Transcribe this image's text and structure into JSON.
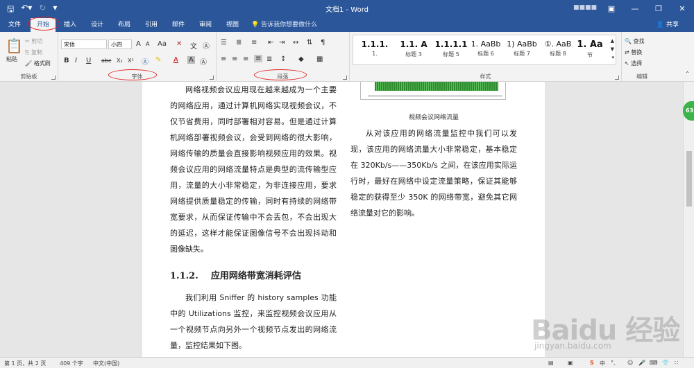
{
  "titlebar": {
    "title": "文档1 - Word",
    "user_label": "■■■■",
    "quick_access": [
      "save",
      "undo",
      "redo",
      "customize"
    ],
    "window_buttons": [
      "ribbon-display",
      "minimize",
      "restore",
      "close"
    ]
  },
  "tabs": {
    "items": [
      "文件",
      "开始",
      "插入",
      "设计",
      "布局",
      "引用",
      "邮件",
      "审阅",
      "视图"
    ],
    "active": "开始",
    "tell_me": "告诉我你想要做什么",
    "share": "共享"
  },
  "ribbon": {
    "clipboard": {
      "paste": "粘贴",
      "cut": "剪切",
      "copy": "复制",
      "format_painter": "格式刷",
      "label": "剪贴板"
    },
    "font": {
      "font_name": "宋体",
      "font_size": "小四",
      "grow": "A",
      "shrink": "A",
      "case": "Aa",
      "label": "字体",
      "buttons": [
        "B",
        "I",
        "U",
        "abc",
        "X₂",
        "X²"
      ]
    },
    "paragraph": {
      "label": "段落"
    },
    "styles": {
      "label": "样式",
      "items": [
        {
          "sample": "1.1.1.",
          "name": "1."
        },
        {
          "sample": "1.1.  A",
          "name": "标题 3"
        },
        {
          "sample": "1.1.1.1",
          "name": "标题 5"
        },
        {
          "sample": "1. AaBb",
          "name": "标题 6"
        },
        {
          "sample": "1) AaBb",
          "name": "标题 7"
        },
        {
          "sample": "①. AaB",
          "name": "标题 8"
        },
        {
          "sample": "1. Aa",
          "name": "节"
        }
      ]
    },
    "editing": {
      "find": "查找",
      "replace": "替换",
      "select": "选择",
      "label": "编辑"
    }
  },
  "document": {
    "col1_para1": "网络视频会议应用现在越来越成为一个主要的网络应用，通过计算机网络实现视频会议，不仅节省费用，同时部署相对容易。但是通过计算机网络部署视频会议，会受到网络的很大影响，网络传输的质量会直接影响视频应用的效果。视频会议应用的网络流量特点是典型的流传输型应用，流量的大小非常稳定，为非连接应用，要求网络提供质量稳定的传输，同时有持续的网络带宽要求，从而保证传输中不会丢包，不会出现大的延迟，这样才能保证图像信号不会出现抖动和图像缺失。",
    "heading": "1.1.2.    应用网络带宽消耗评估",
    "col1_para2": "我们利用 Sniffer 的 history samples 功能中的 Utilizations 监控，来监控视频会议应用从一个视频节点向另外一个视频节点发出的网络流量，监控结果如下图。",
    "figure_caption": "视频会议网络流量",
    "col2_para": "从对该应用的网络流量监控中我们可以发现，该应用的网络流量大小非常稳定，基本稳定在 320Kb/s——350Kb/s 之间，在该应用实际运行时，最好在网络中设定流量策略，保证其能够稳定的获得至少 350K 的网络带宽，避免其它网络流量对它的影响。"
  },
  "scroll_badge": "63",
  "statusbar": {
    "page": "第 1 页，共 2 页",
    "words": "409 个字",
    "language": "中文(中国)"
  },
  "watermark": {
    "main": "Baidu 经验",
    "sub": "jingyan.baidu.com"
  },
  "colors": {
    "accent": "#2b579a",
    "annotation": "#e02020"
  }
}
